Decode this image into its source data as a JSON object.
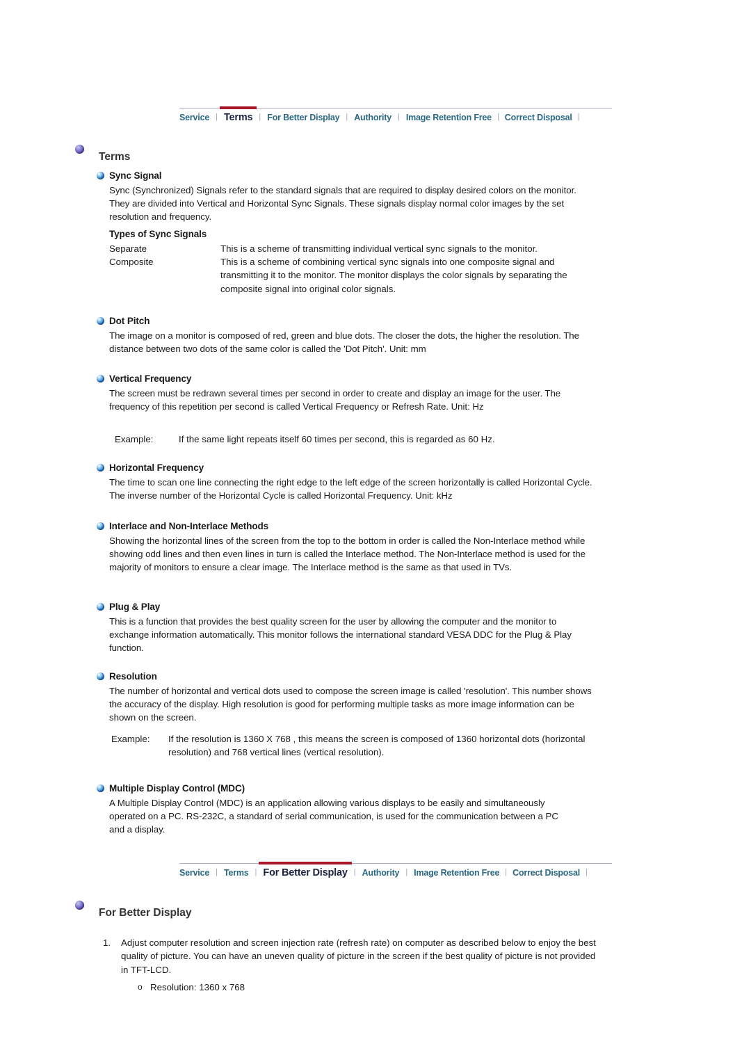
{
  "nav_top": {
    "items": [
      {
        "label": "Service",
        "active": false
      },
      {
        "label": "Terms",
        "active": true
      },
      {
        "label": "For Better Display",
        "active": false
      },
      {
        "label": "Authority",
        "active": false
      },
      {
        "label": "Image Retention Free",
        "active": false
      },
      {
        "label": "Correct Disposal",
        "active": false
      }
    ],
    "separator": "|"
  },
  "nav_bottom": {
    "items": [
      {
        "label": "Service",
        "active": false
      },
      {
        "label": "Terms",
        "active": false
      },
      {
        "label": "For Better Display",
        "active": true
      },
      {
        "label": "Authority",
        "active": false
      },
      {
        "label": "Image Retention Free",
        "active": false
      },
      {
        "label": "Correct Disposal",
        "active": false
      }
    ],
    "separator": "|"
  },
  "terms": {
    "heading": "Terms",
    "sync_signal": {
      "title": "Sync Signal",
      "body": "Sync (Synchronized) Signals refer to the standard signals that are required to display desired colors on the monitor. They are divided into Vertical and Horizontal Sync Signals. These signals display normal color images by the set resolution and frequency.",
      "table_title": "Types of Sync Signals",
      "rows": [
        {
          "term": "Separate",
          "desc": "This is a scheme of transmitting individual vertical sync signals to the monitor."
        },
        {
          "term": "Composite",
          "desc": "This is a scheme of combining vertical sync signals into one composite signal and transmitting it to the monitor. The monitor displays the color signals by separating the composite signal into original color signals."
        }
      ]
    },
    "dot_pitch": {
      "title": "Dot Pitch",
      "body": "The image on a monitor is composed of red, green and blue dots. The closer the dots, the higher the resolution. The distance between two dots of the same color is called the 'Dot Pitch'. Unit: mm"
    },
    "vertical_frequency": {
      "title": "Vertical Frequency",
      "body": "The screen must be redrawn several times per second in order to create and display an image for the user. The frequency of this repetition per second is called Vertical Frequency or Refresh Rate. Unit: Hz",
      "example_label": "Example:",
      "example_text": "If the same light repeats itself 60 times per second, this is regarded as 60 Hz."
    },
    "horizontal_frequency": {
      "title": "Horizontal Frequency",
      "body": "The time to scan one line connecting the right edge to the left edge of the screen horizontally is called Horizontal Cycle. The inverse number of the Horizontal Cycle is called Horizontal Frequency. Unit: kHz"
    },
    "interlace": {
      "title": "Interlace and Non-Interlace Methods",
      "body": "Showing the horizontal lines of the screen from the top to the bottom in order is called the Non-Interlace method while showing odd lines and then even lines in turn is called the Interlace method. The Non-Interlace method is used for the majority of monitors to ensure a clear image. The Interlace method is the same as that used in TVs."
    },
    "plug_and_play": {
      "title": "Plug & Play",
      "body": "This is a function that provides the best quality screen for the user by allowing the computer and the monitor to exchange information automatically. This monitor follows the international standard VESA DDC for the Plug & Play function."
    },
    "resolution": {
      "title": "Resolution",
      "body": "The number of horizontal and vertical dots used to compose the screen image is called 'resolution'. This number shows the accuracy of the display. High resolution is good for performing multiple tasks as more image information can be shown on the screen.",
      "example_label": "Example:",
      "example_text": "If the resolution is 1360 X 768 , this means the screen is composed of 1360 horizontal dots (horizontal resolution) and 768 vertical lines (vertical resolution)."
    },
    "mdc": {
      "title": "Multiple Display Control (MDC)",
      "body": "A Multiple Display Control (MDC) is an application allowing various displays to be easily and simultaneously operated on a PC. RS-232C, a standard of serial communication, is used for the communication between a PC and a display."
    }
  },
  "better_display": {
    "heading": "For Better Display",
    "item1_number": "1.",
    "item1_text": "Adjust computer resolution and screen injection rate (refresh rate) on computer as described below to enjoy the best quality of picture. You can have an uneven quality of picture in the screen if the best quality of picture is not provided in TFT-LCD.",
    "sub_marker": "o",
    "sub_text": "Resolution: 1360 x 768"
  },
  "colors": {
    "nav_link": "#2b6884",
    "nav_active": "#1b2340",
    "accent_red": "#aa1527",
    "rule": "#b0aebe",
    "heading": "#333333",
    "text": "#1a1a1a"
  }
}
